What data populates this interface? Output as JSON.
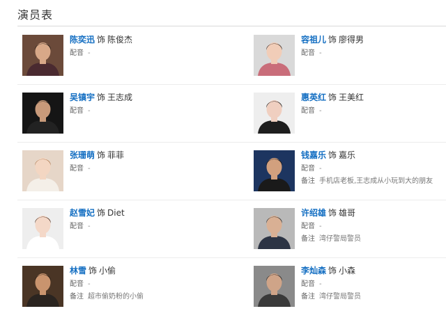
{
  "section_title": "演员表",
  "cast": [
    {
      "actor": "陈奕迅",
      "as": "饰",
      "role": "陈俊杰",
      "dub_label": "配音",
      "dub_value": "-",
      "note_label": "",
      "note_value": "",
      "bg": "#6b4a3a",
      "skin": "#d8a888",
      "hair": "#1a1410",
      "shirt": "#4a2a30"
    },
    {
      "actor": "容祖儿",
      "as": "饰",
      "role": "廖得男",
      "dub_label": "配音",
      "dub_value": "-",
      "note_label": "",
      "note_value": "",
      "bg": "#d9d9d9",
      "skin": "#f1cdb8",
      "hair": "#3a2a22",
      "shirt": "#c96d7a"
    },
    {
      "actor": "吴镇宇",
      "as": "饰",
      "role": "王志成",
      "dub_label": "配音",
      "dub_value": "-",
      "note_label": "",
      "note_value": "",
      "bg": "#151515",
      "skin": "#c89a7a",
      "hair": "#0f0f0f",
      "shirt": "#222222"
    },
    {
      "actor": "惠英红",
      "as": "饰",
      "role": "王美红",
      "dub_label": "配音",
      "dub_value": "-",
      "note_label": "",
      "note_value": "",
      "bg": "#eeeeee",
      "skin": "#f0cfc0",
      "hair": "#141414",
      "shirt": "#1e1e1e"
    },
    {
      "actor": "张珊萌",
      "as": "饰",
      "role": "菲菲",
      "dub_label": "配音",
      "dub_value": "-",
      "note_label": "",
      "note_value": "",
      "bg": "#e6d6c8",
      "skin": "#f3d6c2",
      "hair": "#b07d55",
      "shirt": "#f4efe8"
    },
    {
      "actor": "钱嘉乐",
      "as": "饰",
      "role": "嘉乐",
      "dub_label": "配音",
      "dub_value": "-",
      "note_label": "备注",
      "note_value": "手机店老板,王志成从小玩到大的朋友",
      "bg": "#1d3560",
      "skin": "#d2a07e",
      "hair": "#111111",
      "shirt": "#1a1a1a"
    },
    {
      "actor": "赵雪妃",
      "as": "饰",
      "role": "Diet",
      "dub_label": "配音",
      "dub_value": "-",
      "note_label": "",
      "note_value": "",
      "bg": "#eeeeee",
      "skin": "#f4d8c8",
      "hair": "#4a2a1a",
      "shirt": "#ffffff"
    },
    {
      "actor": "许绍雄",
      "as": "饰",
      "role": "雄哥",
      "dub_label": "配音",
      "dub_value": "-",
      "note_label": "备注",
      "note_value": "湾仔警局警员",
      "bg": "#b9b9b9",
      "skin": "#d9b094",
      "hair": "#2a2a2a",
      "shirt": "#2c3444"
    },
    {
      "actor": "林雪",
      "as": "饰",
      "role": "小偷",
      "dub_label": "配音",
      "dub_value": "-",
      "note_label": "备注",
      "note_value": "超市偷奶粉的小偷",
      "bg": "#4a3525",
      "skin": "#c9946e",
      "hair": "#1a1410",
      "shirt": "#2a2420"
    },
    {
      "actor": "李灿森",
      "as": "饰",
      "role": "小森",
      "dub_label": "配音",
      "dub_value": "-",
      "note_label": "备注",
      "note_value": "湾仔警局警员",
      "bg": "#8a8a8a",
      "skin": "#cfa488",
      "hair": "#222222",
      "shirt": "#3a3a3a"
    }
  ]
}
